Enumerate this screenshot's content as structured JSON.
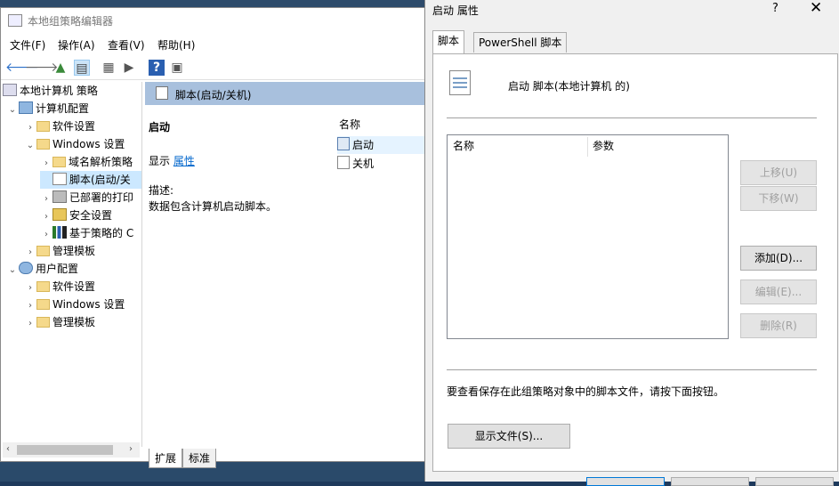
{
  "editor": {
    "title": "本地组策略编辑器",
    "menu": [
      "文件(F)",
      "操作(A)",
      "查看(V)",
      "帮助(H)"
    ],
    "tree": [
      {
        "label": "本地计算机 策略",
        "level": 0,
        "exp": ""
      },
      {
        "label": "计算机配置",
        "level": 0,
        "exp": "v"
      },
      {
        "label": "软件设置",
        "level": 1,
        "exp": ">"
      },
      {
        "label": "Windows 设置",
        "level": 1,
        "exp": "v"
      },
      {
        "label": "域名解析策略",
        "level": 2,
        "exp": ">"
      },
      {
        "label": "脚本(启动/关",
        "level": 2,
        "exp": ""
      },
      {
        "label": "已部署的打印",
        "level": 2,
        "exp": ">"
      },
      {
        "label": "安全设置",
        "level": 2,
        "exp": ">"
      },
      {
        "label": "基于策略的 C",
        "level": 2,
        "exp": ">"
      },
      {
        "label": "管理模板",
        "level": 1,
        "exp": ">"
      },
      {
        "label": "用户配置",
        "level": 0,
        "exp": "v"
      },
      {
        "label": "软件设置",
        "level": 1,
        "exp": ">"
      },
      {
        "label": "Windows 设置",
        "level": 1,
        "exp": ">"
      },
      {
        "label": "管理模板",
        "level": 1,
        "exp": ">"
      }
    ],
    "content_header": "脚本(启动/关机)",
    "extended_title": "启动",
    "show_label": "显示",
    "show_link": "属性",
    "desc_label": "描述:",
    "desc_text": "数据包含计算机启动脚本。",
    "list_header": "名称",
    "list_items": [
      "启动",
      "关机"
    ],
    "bottom_tabs": [
      "扩展",
      "标准"
    ]
  },
  "dialog": {
    "title": "启动 属性",
    "help": "?",
    "close": "✕",
    "tabs": [
      "脚本",
      "PowerShell 脚本"
    ],
    "heading": "启动 脚本(本地计算机 的)",
    "columns": [
      "名称",
      "参数"
    ],
    "buttons": {
      "up": "上移(U)",
      "down": "下移(W)",
      "add": "添加(D)...",
      "edit": "编辑(E)...",
      "remove": "删除(R)"
    },
    "info": "要查看保存在此组策略对象中的脚本文件，请按下面按钮。",
    "show_files": "显示文件(S)..."
  },
  "colors": {
    "accent": "#0066cc",
    "selection": "#cce8ff",
    "header": "#a8c0dd"
  }
}
